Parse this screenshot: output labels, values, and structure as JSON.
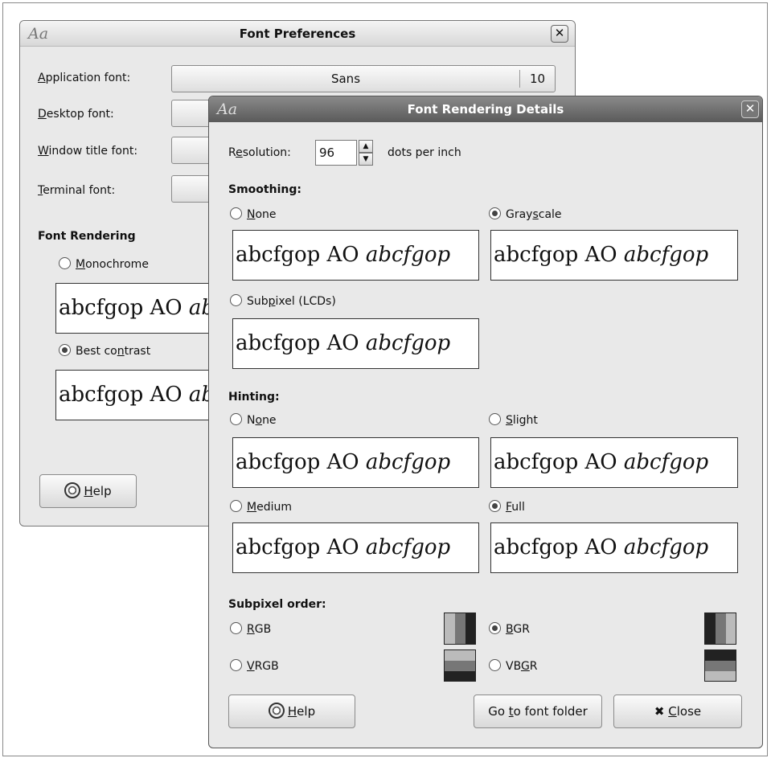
{
  "prefs": {
    "title": "Font Preferences",
    "rows": [
      {
        "label_u": "A",
        "label_rest": "pplication font:",
        "font": "Sans",
        "size": "10"
      },
      {
        "label_u": "D",
        "label_rest": "esktop font:"
      },
      {
        "label_u": "W",
        "label_rest": "indow title font:"
      },
      {
        "label_u": "T",
        "label_rest": "erminal font:"
      }
    ],
    "rendering_heading": "Font Rendering",
    "monochrome": {
      "u": "M",
      "rest": "onochrome"
    },
    "best_contrast": {
      "pre": "Best co",
      "u": "n",
      "rest": "trast"
    },
    "help": {
      "u": "H",
      "rest": "elp"
    }
  },
  "details": {
    "title": "Font Rendering Details",
    "resolution": {
      "pre": "R",
      "u": "e",
      "rest": "solution:",
      "value": "96",
      "unit": "dots per inch"
    },
    "smoothing": {
      "heading": "Smoothing",
      "none": {
        "u": "N",
        "rest": "one"
      },
      "grayscale": {
        "pre": "Gray",
        "u": "s",
        "rest": "cale"
      },
      "subpixel": {
        "pre": "Sub",
        "u": "p",
        "rest": "ixel (LCDs)"
      }
    },
    "hinting": {
      "heading": "Hinting",
      "none": {
        "pre": "N",
        "u": "o",
        "rest": "ne"
      },
      "slight": {
        "u": "S",
        "rest": "light"
      },
      "medium": {
        "u": "M",
        "rest": "edium"
      },
      "full": {
        "u": "F",
        "rest": "ull"
      }
    },
    "subpixel_order": {
      "heading": "Subpixel order",
      "rgb": {
        "u": "R",
        "rest": "GB"
      },
      "bgr": {
        "u": "B",
        "rest": "GR"
      },
      "vrgb": {
        "u": "V",
        "rest": "RGB"
      },
      "vbgr": {
        "pre": "VB",
        "u": "G",
        "rest": "R"
      }
    },
    "help": {
      "u": "H",
      "rest": "elp"
    },
    "goto": {
      "pre": "Go ",
      "u": "t",
      "rest": "o font folder"
    },
    "close": {
      "u": "C",
      "rest": "lose"
    }
  },
  "sample": {
    "plain": "abcfgop AO ",
    "italic": "abcfgop"
  },
  "selected": {
    "prefs_rendering": "best_contrast",
    "smoothing": "grayscale",
    "hinting": "full",
    "subpixel_order": "bgr"
  }
}
